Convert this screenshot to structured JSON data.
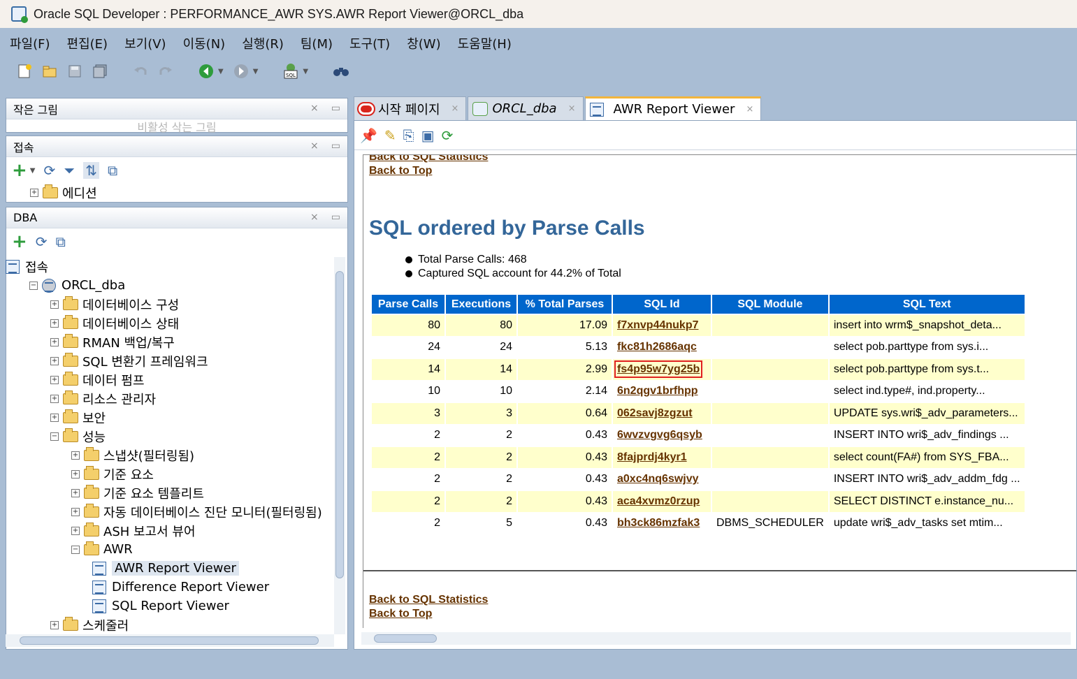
{
  "window": {
    "title": "Oracle SQL Developer : PERFORMANCE_AWR SYS.AWR Report Viewer@ORCL_dba"
  },
  "menu": [
    "파일(F)",
    "편집(E)",
    "보기(V)",
    "이동(N)",
    "실행(R)",
    "팀(M)",
    "도구(T)",
    "창(W)",
    "도움말(H)"
  ],
  "panels": {
    "thumbnail": {
      "title": "작은 그림",
      "placeholder": "비활성 삭는 그림"
    },
    "connections": {
      "title": "접속",
      "node": "에디션"
    },
    "dba": {
      "title": "DBA"
    }
  },
  "tree": [
    {
      "label": "접속",
      "indent": 0,
      "exp": ""
    },
    {
      "label": "ORCL_dba",
      "indent": 1,
      "exp": "−"
    },
    {
      "label": "데이터베이스 구성",
      "indent": 2,
      "exp": "+"
    },
    {
      "label": "데이터베이스 상태",
      "indent": 2,
      "exp": "+"
    },
    {
      "label": "RMAN 백업/복구",
      "indent": 2,
      "exp": "+"
    },
    {
      "label": "SQL 변환기 프레임워크",
      "indent": 2,
      "exp": "+"
    },
    {
      "label": "데이터 펌프",
      "indent": 2,
      "exp": "+"
    },
    {
      "label": "리소스 관리자",
      "indent": 2,
      "exp": "+"
    },
    {
      "label": "보안",
      "indent": 2,
      "exp": "+"
    },
    {
      "label": "성능",
      "indent": 2,
      "exp": "−"
    },
    {
      "label": "스냅샷(필터링됨)",
      "indent": 3,
      "exp": "+"
    },
    {
      "label": "기준 요소",
      "indent": 3,
      "exp": "+"
    },
    {
      "label": "기준 요소 템플리트",
      "indent": 3,
      "exp": "+"
    },
    {
      "label": "자동 데이터베이스 진단 모니터(필터링됨)",
      "indent": 3,
      "exp": "+"
    },
    {
      "label": "ASH 보고서 뷰어",
      "indent": 3,
      "exp": "+"
    },
    {
      "label": "AWR",
      "indent": 3,
      "exp": "−"
    },
    {
      "label": "AWR Report Viewer",
      "indent": 4,
      "exp": "",
      "selected": true
    },
    {
      "label": "Difference Report Viewer",
      "indent": 4,
      "exp": ""
    },
    {
      "label": "SQL Report Viewer",
      "indent": 4,
      "exp": ""
    },
    {
      "label": "스케줄러",
      "indent": 2,
      "exp": "+"
    }
  ],
  "tabs": [
    {
      "label": "시작 페이지",
      "active": false
    },
    {
      "label": "ORCL_dba",
      "active": false
    },
    {
      "label": "AWR Report Viewer",
      "active": true
    }
  ],
  "report": {
    "link_stats": "Back to SQL Statistics",
    "link_top": "Back to Top",
    "heading": "SQL ordered by Parse Calls",
    "bullets": [
      "Total Parse Calls: 468",
      "Captured SQL account for 44.2% of Total"
    ],
    "columns": [
      "Parse Calls",
      "Executions",
      "% Total Parses",
      "SQL Id",
      "SQL Module",
      "SQL Text"
    ],
    "rows": [
      [
        "80",
        "80",
        "17.09",
        "f7xnvp44nukp7",
        "",
        "insert into wrm$_snapshot_deta..."
      ],
      [
        "24",
        "24",
        "5.13",
        "fkc81h2686aqc",
        "",
        "select pob.parttype from sys.i..."
      ],
      [
        "14",
        "14",
        "2.99",
        "fs4p95w7yg25b",
        "",
        "select pob.parttype from sys.t..."
      ],
      [
        "10",
        "10",
        "2.14",
        "6n2qgv1brfhpp",
        "",
        "select ind.type#, ind.property..."
      ],
      [
        "3",
        "3",
        "0.64",
        "062savj8zgzut",
        "",
        "UPDATE sys.wri$_adv_parameters..."
      ],
      [
        "2",
        "2",
        "0.43",
        "6wvzvgvg6qsyb",
        "",
        "INSERT INTO wri$_adv_findings ..."
      ],
      [
        "2",
        "2",
        "0.43",
        "8fajprdj4kyr1",
        "",
        "select count(FA#) from SYS_FBA..."
      ],
      [
        "2",
        "2",
        "0.43",
        "a0xc4nq6swjvy",
        "",
        "INSERT INTO wri$_adv_addm_fdg ..."
      ],
      [
        "2",
        "2",
        "0.43",
        "aca4xvmz0rzup",
        "",
        "SELECT DISTINCT e.instance_nu..."
      ],
      [
        "2",
        "5",
        "0.43",
        "bh3ck86mzfak3",
        "DBMS_SCHEDULER",
        "update wri$_adv_tasks set mtim..."
      ]
    ],
    "highlighted_sql_id": "fs4p95w7yg25b"
  }
}
